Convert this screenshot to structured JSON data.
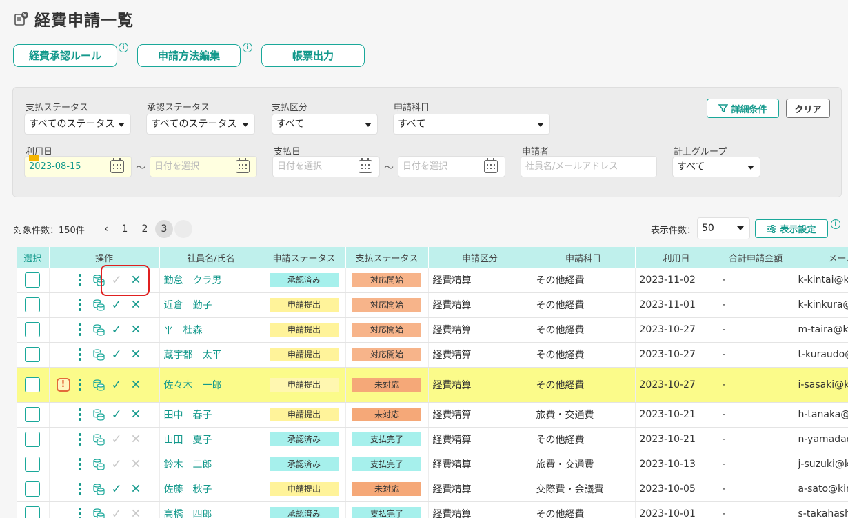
{
  "page": {
    "title": "経費申請一覧"
  },
  "top_buttons": {
    "approval_rule": "経費承認ルール",
    "method_edit": "申請方法編集",
    "report_output": "帳票出力",
    "info": "i"
  },
  "filters": {
    "pay_status_label": "支払ステータス",
    "pay_status_value": "すべてのステータス",
    "approval_status_label": "承認ステータス",
    "approval_status_value": "すべてのステータス",
    "pay_type_label": "支払区分",
    "pay_type_value": "すべて",
    "subject_label": "申請科目",
    "subject_value": "すべて",
    "use_date_label": "利用日",
    "use_date_from": "2023-08-15",
    "use_date_to_placeholder": "日付を選択",
    "pay_date_label": "支払日",
    "pay_date_from_placeholder": "日付を選択",
    "pay_date_to_placeholder": "日付を選択",
    "applicant_label": "申請者",
    "applicant_placeholder": "社員名/メールアドレス",
    "group_label": "計上グループ",
    "group_value": "すべて",
    "tilde": "〜",
    "detail_button": "詳細条件",
    "clear_button": "クリア"
  },
  "list_header": {
    "count": "対象件数：150件",
    "pages": [
      "1",
      "2",
      "3"
    ],
    "prev": "‹",
    "per_page_label": "表示件数：",
    "per_page_value": "50",
    "display_settings": "表示設定"
  },
  "table": {
    "columns": [
      "選択",
      "操作",
      "社員名/氏名",
      "申請ステータス",
      "支払ステータス",
      "申請区分",
      "申請科目",
      "利用日",
      "合計申請金額",
      "メールア"
    ],
    "rows": [
      {
        "name": "勤怠　クラ男",
        "approval": "承認済み",
        "payment": "対応開始",
        "type": "経費精算",
        "subject": "その他経費",
        "date": "2023-11-02",
        "amount": "-",
        "email": "k-kintai@ki"
      },
      {
        "name": "近倉　勤子",
        "approval": "申請提出",
        "payment": "対応開始",
        "type": "経費精算",
        "subject": "その他経費",
        "date": "2023-11-01",
        "amount": "-",
        "email": "k-kinkura@"
      },
      {
        "name": "平　杜森",
        "approval": "申請提出",
        "payment": "対応開始",
        "type": "経費精算",
        "subject": "その他経費",
        "date": "2023-10-27",
        "amount": "-",
        "email": "m-taira@ki"
      },
      {
        "name": "蔵宇都　太平",
        "approval": "申請提出",
        "payment": "対応開始",
        "type": "経費精算",
        "subject": "その他経費",
        "date": "2023-10-27",
        "amount": "-",
        "email": "t-kuraudo@"
      },
      {
        "name": "佐々木　一郎",
        "approval": "申請提出",
        "payment": "未対応",
        "type": "経費精算",
        "subject": "その他経費",
        "date": "2023-10-27",
        "amount": "-",
        "email": "i-sasaki@ki"
      },
      {
        "name": "田中　春子",
        "approval": "申請提出",
        "payment": "未対応",
        "type": "経費精算",
        "subject": "旅費・交通費",
        "date": "2023-10-21",
        "amount": "-",
        "email": "h-tanaka@"
      },
      {
        "name": "山田　夏子",
        "approval": "承認済み",
        "payment": "支払完了",
        "type": "経費精算",
        "subject": "その他経費",
        "date": "2023-10-21",
        "amount": "-",
        "email": "n-yamada@"
      },
      {
        "name": "鈴木　二郎",
        "approval": "承認済み",
        "payment": "支払完了",
        "type": "経費精算",
        "subject": "旅費・交通費",
        "date": "2023-10-13",
        "amount": "-",
        "email": "j-suzuki@ki"
      },
      {
        "name": "佐藤　秋子",
        "approval": "申請提出",
        "payment": "未対応",
        "type": "経費精算",
        "subject": "交際費・会議費",
        "date": "2023-10-05",
        "amount": "-",
        "email": "a-sato@kin"
      },
      {
        "name": "高橋　四郎",
        "approval": "承認済み",
        "payment": "支払完了",
        "type": "経費精算",
        "subject": "その他経費",
        "date": "2023-10-01",
        "amount": "-",
        "email": "s-takahash"
      }
    ],
    "warning_mark": "!"
  }
}
